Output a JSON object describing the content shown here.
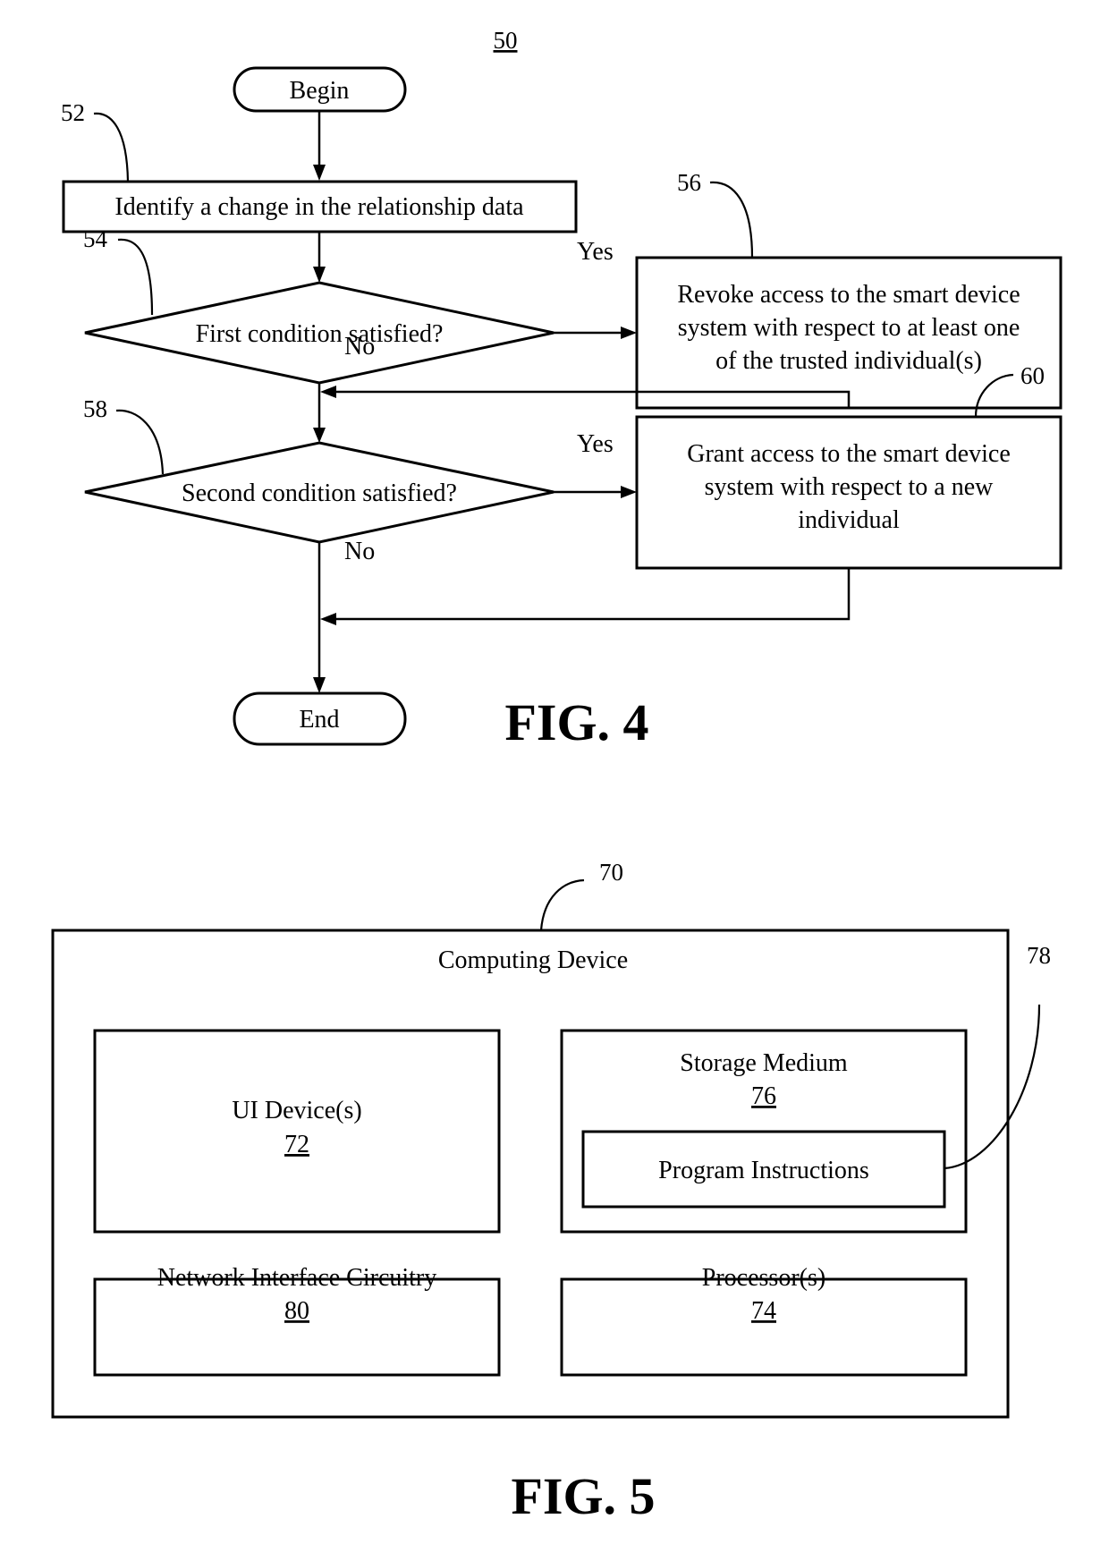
{
  "fig4": {
    "figure_ref": "50",
    "caption": "FIG. 4",
    "begin": "Begin",
    "end": "End",
    "step_52": {
      "ref": "52",
      "text": "Identify a change in the relationship data"
    },
    "decision_54": {
      "ref": "54",
      "text": "First condition satisfied?",
      "yes": "Yes",
      "no": "No"
    },
    "step_56": {
      "ref": "56",
      "lines": [
        "Revoke access to the smart device",
        "system with respect to at least one",
        "of the trusted individual(s)"
      ]
    },
    "decision_58": {
      "ref": "58",
      "text": "Second condition satisfied?",
      "yes": "Yes",
      "no": "No"
    },
    "step_60": {
      "ref": "60",
      "lines": [
        "Grant access to the smart device",
        "system with respect to a new",
        "individual"
      ]
    }
  },
  "fig5": {
    "caption": "FIG. 5",
    "device": {
      "ref": "70",
      "title": "Computing Device"
    },
    "ui_devices": {
      "label": "UI Device(s)",
      "ref": "72"
    },
    "storage_medium": {
      "label": "Storage Medium",
      "ref": "76"
    },
    "program_instructions": {
      "label": "Program Instructions",
      "ref": "78"
    },
    "network_interface": {
      "label": "Network Interface Circuitry",
      "ref": "80"
    },
    "processors": {
      "label": "Processor(s)",
      "ref": "74"
    }
  }
}
